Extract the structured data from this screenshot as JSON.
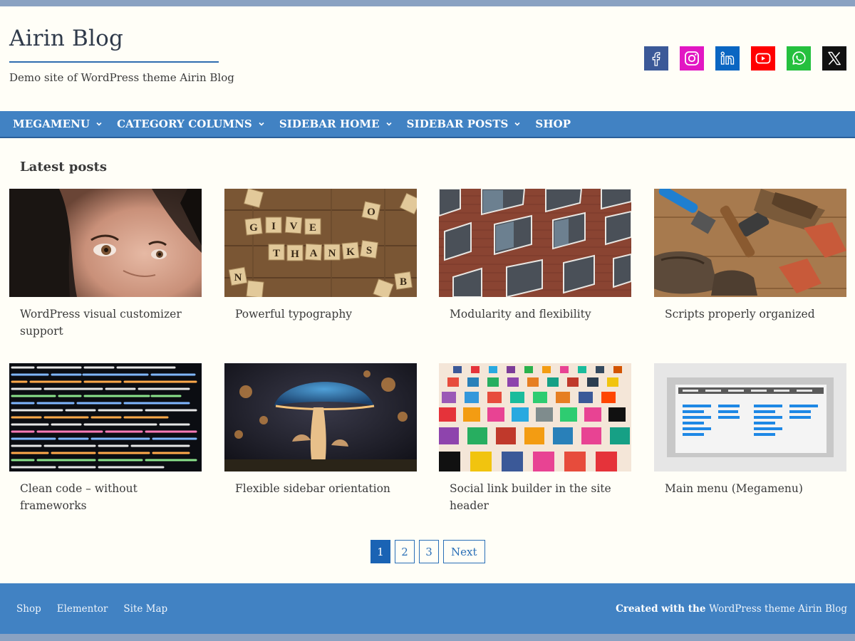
{
  "site": {
    "title": "Airin Blog",
    "tagline": "Demo site of WordPress theme Airin Blog"
  },
  "socials": [
    {
      "name": "facebook",
      "icon": "facebook-icon",
      "color": "#3b5998"
    },
    {
      "name": "instagram",
      "icon": "instagram-icon",
      "color": "#e216c3"
    },
    {
      "name": "linkedin",
      "icon": "linkedin-icon",
      "color": "#0a66c2"
    },
    {
      "name": "youtube",
      "icon": "youtube-icon",
      "color": "#ff0000"
    },
    {
      "name": "whatsapp",
      "icon": "whatsapp-icon",
      "color": "#25c03e"
    },
    {
      "name": "x",
      "icon": "x-icon",
      "color": "#111111"
    }
  ],
  "nav": {
    "items": [
      {
        "label": "MEGAMENU",
        "has_dropdown": true
      },
      {
        "label": "CATEGORY COLUMNS",
        "has_dropdown": true
      },
      {
        "label": "SIDEBAR HOME",
        "has_dropdown": true
      },
      {
        "label": "SIDEBAR POSTS",
        "has_dropdown": true
      },
      {
        "label": "SHOP",
        "has_dropdown": false
      }
    ]
  },
  "latest": {
    "heading": "Latest posts",
    "posts": [
      {
        "title": "WordPress visual customizer support",
        "image": "woman-face-photo"
      },
      {
        "title": "Powerful typography",
        "image": "scrabble-give-thanks-photo"
      },
      {
        "title": "Modularity and flexibility",
        "image": "brick-building-windows-photo"
      },
      {
        "title": "Scripts properly organized",
        "image": "tools-on-wood-photo"
      },
      {
        "title": "Clean code – without frameworks",
        "image": "code-screen-photo"
      },
      {
        "title": "Flexible sidebar orientation",
        "image": "glowing-mushroom-photo"
      },
      {
        "title": "Social link builder in the site header",
        "image": "social-icons-grid-photo"
      },
      {
        "title": "Main menu (Megamenu)",
        "image": "megamenu-illustration"
      }
    ]
  },
  "pagination": {
    "pages": [
      "1",
      "2",
      "3"
    ],
    "current": "1",
    "next_label": "Next"
  },
  "footer": {
    "links": [
      "Shop",
      "Elementor",
      "Site Map"
    ],
    "credit_prefix": "Created with the ",
    "credit_link": "WordPress theme Airin Blog"
  },
  "colors": {
    "background": "#fffef7",
    "nav": "#4182c3",
    "accent": "#1a63b4"
  }
}
